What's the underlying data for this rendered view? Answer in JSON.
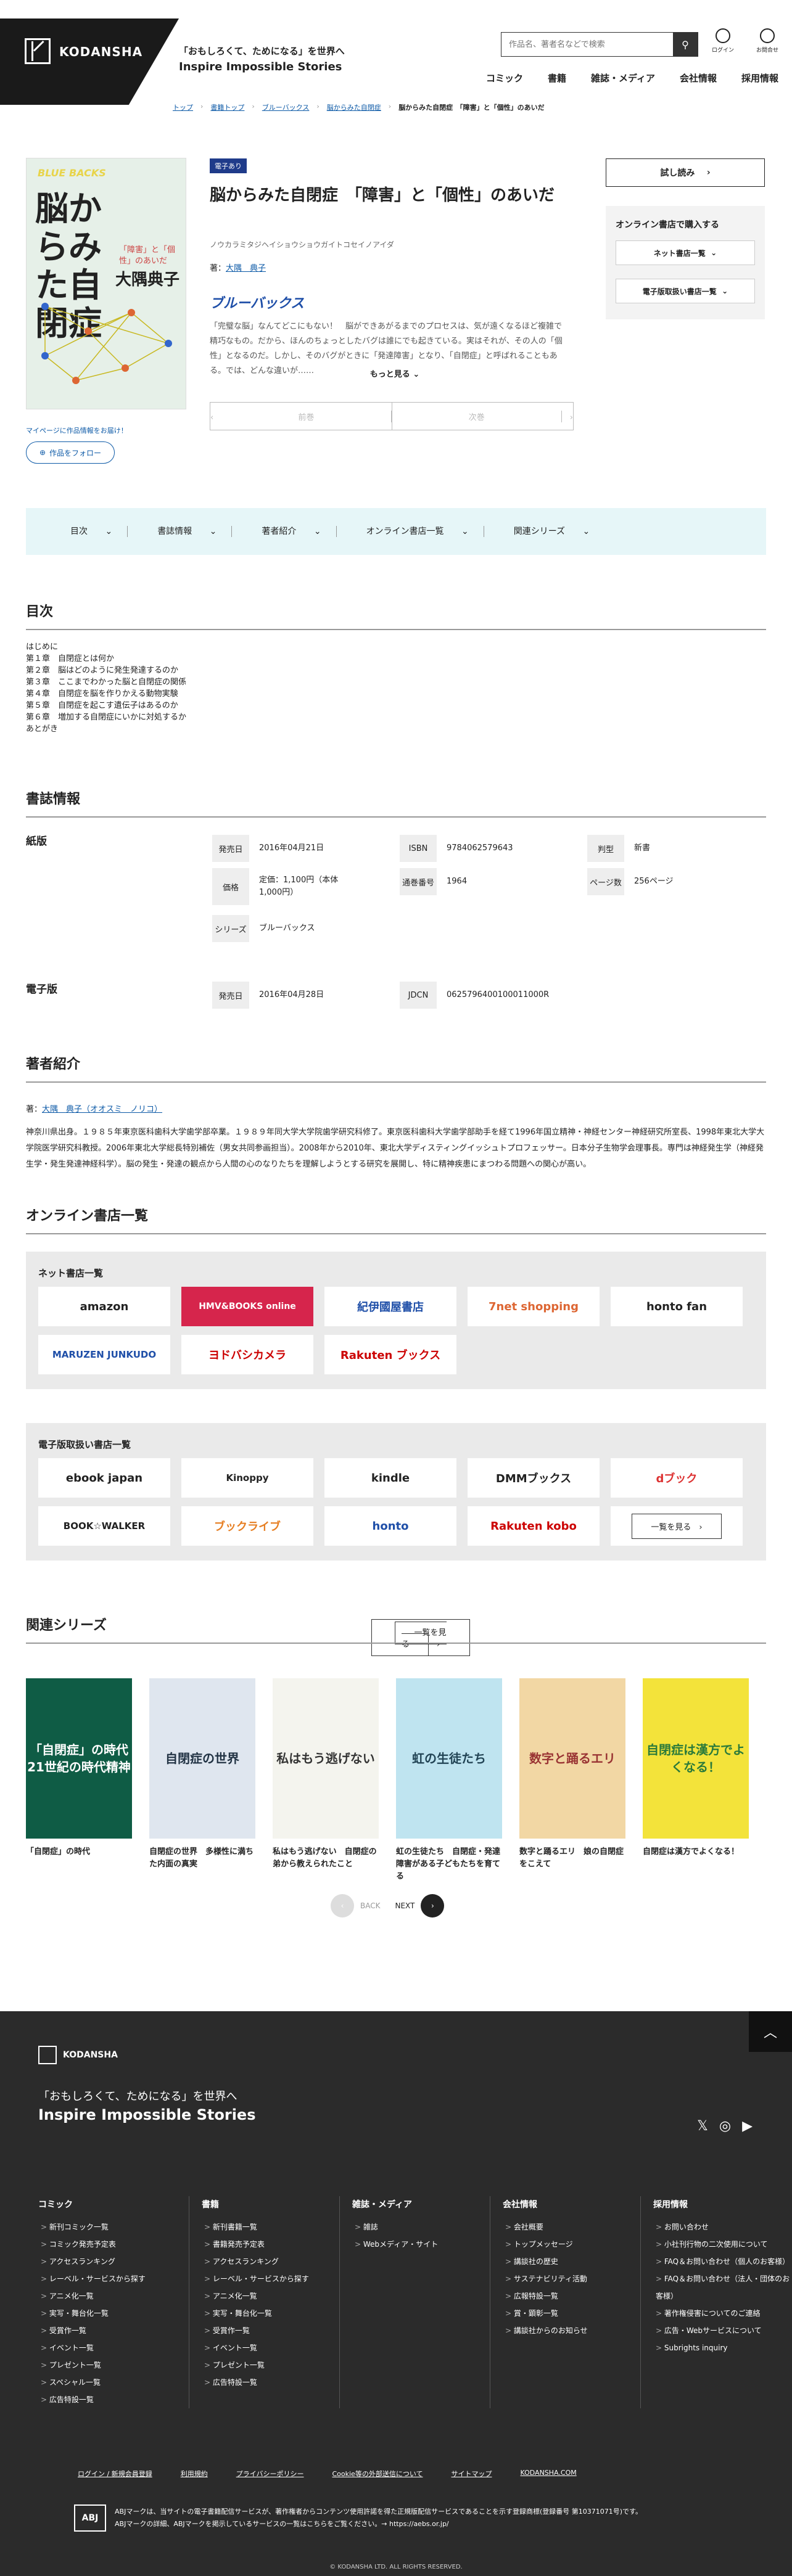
{
  "header": {
    "logo": "KODANSHA",
    "tagline1": "「おもしろくて、ためになる」を世界へ",
    "tagline2": "Inspire Impossible Stories",
    "search_placeholder": "作品名、著者名などで検索",
    "login": "ログイン",
    "notice": "お問合せ",
    "nav": [
      "コミック",
      "書籍",
      "雑誌・メディア",
      "会社情報",
      "採用情報"
    ]
  },
  "breadcrumb": {
    "items": [
      "トップ",
      "書籍トップ",
      "ブルーバックス",
      "脳からみた自閉症"
    ],
    "current": "脳からみた自閉症　「障害」と「個性」のあいだ"
  },
  "book": {
    "cover_series": "BLUE BACKS",
    "cover_title": "脳からみた自閉症",
    "cover_subtitle": "「障害」と「個性」のあいだ",
    "cover_author": "大隅典子",
    "badge": "電子あり",
    "title": "脳からみた自閉症　「障害」と「個性」のあいだ",
    "kana": "ノウカラミタジヘイショウショウガイトコセイノアイダ",
    "author_label": "著：",
    "author": "大隅　典子",
    "series_logo": "ブルーバックス",
    "description": "「完璧な脳」なんてどこにもない！　脳ができあがるまでのプロセスは、気が遠くなるほど複雑で精巧なもの。だから、ほんのちょっとしたバグは誰にでも起きている。実はそれが、その人の「個性」となるのだ。しかし、そのバグがときに「発達障害」となり、「自閉症」と呼ばれることもある。では、どんな違いが……",
    "more": "もっと見る",
    "prev": "前巻",
    "next": "次巻",
    "follow_note": "マイページに作品情報をお届け！",
    "follow": "作品をフォロー",
    "trial": "試し読み",
    "buy_heading": "オンライン書店で購入する",
    "net_stores": "ネット書店一覧",
    "ebook_stores": "電子版取扱い書店一覧"
  },
  "tabs": [
    "目次",
    "書誌情報",
    "著者紹介",
    "オンライン書店一覧",
    "関連シリーズ"
  ],
  "toc": {
    "heading": "目次",
    "items": [
      "はじめに",
      "第１章　自閉症とは何か",
      "第２章　脳はどのように発生発達するのか",
      "第３章　ここまでわかった脳と自閉症の関係",
      "第４章　自閉症を脳を作りかえる動物実験",
      "第５章　自閉症を起こす遺伝子はあるのか",
      "第６章　増加する自閉症にいかに対処するか",
      "あとがき"
    ]
  },
  "biblio": {
    "heading": "書誌情報",
    "paper": "紙版",
    "ebook": "電子版",
    "paper_rows": [
      [
        "発売日",
        "2016年04月21日"
      ],
      [
        "ISBN",
        "9784062579643"
      ],
      [
        "判型",
        "新書"
      ],
      [
        "価格",
        "定価：1,100円（本体1,000円）"
      ],
      [
        "通巻番号",
        "1964"
      ],
      [
        "ページ数",
        "256ページ"
      ],
      [
        "シリーズ",
        "ブルーバックス"
      ]
    ],
    "ebook_rows": [
      [
        "発売日",
        "2016年04月28日"
      ],
      [
        "JDCN",
        "0625796400100011000R"
      ]
    ]
  },
  "bio": {
    "heading": "著者紹介",
    "label": "著：",
    "name": "大隅　典子（オオスミ　ノリコ）",
    "text": "神奈川県出身。１９８５年東京医科歯科大学歯学部卒業。１９８９年同大学大学院歯学研究科修了。東京医科歯科大学歯学部助手を経て1996年国立精神・神経センター神経研究所室長、1998年東北大学大学院医学研究科教授。2006年東北大学総長特別補佐（男女共同参画担当）。2008年から2010年、東北大学ディスティングイッシュトプロフェッサー。日本分子生物学会理事長。専門は神経発生学（神経発生学・発生発達神経科学）。脳の発生・発達の観点から人間の心のなりたちを理解しようとする研究を展開し、特に精神疾患にまつわる問題への関心が高い。"
  },
  "stores": {
    "heading": "オンライン書店一覧",
    "net_heading": "ネット書店一覧",
    "net": [
      "amazon",
      "HMV&BOOKS online",
      "紀伊國屋書店",
      "7net shopping",
      "honto fan",
      "MARUZEN JUNKUDO",
      "ヨドバシカメラ",
      "Rakuten ブックス"
    ],
    "ebook_heading": "電子版取扱い書店一覧",
    "ebook": [
      "ebook japan",
      "Kinoppy",
      "kindle",
      "DMMブックス",
      "dブック",
      "BOOK☆WALKER",
      "ブックライブ",
      "honto",
      "Rakuten kobo"
    ],
    "more": "一覧を見る"
  },
  "series": {
    "heading": "関連シリーズ",
    "items": [
      {
        "cover": "「自閉症」の時代 21世紀の時代精神",
        "title": "「自閉症」の時代"
      },
      {
        "cover": "自閉症の世界",
        "title": "自閉症の世界　多様性に満ちた内面の真実"
      },
      {
        "cover": "私はもう逃げない",
        "title": "私はもう逃げない　自閉症の弟から教えられたこと"
      },
      {
        "cover": "虹の生徒たち",
        "title": "虹の生徒たち　自閉症・発達障害がある子どもたちを育てる"
      },
      {
        "cover": "数字と踊るエリ",
        "title": "数字と踊るエリ　娘の自閉症をこえて"
      },
      {
        "cover": "自閉症は漢方でよくなる！",
        "title": "自閉症は漢方でよくなる！"
      }
    ],
    "back": "BACK",
    "next": "NEXT"
  },
  "footer": {
    "logo": "KODANSHA",
    "slogan1": "「おもしろくて、ためになる」を世界へ",
    "slogan2": "Inspire Impossible Stories",
    "cols": [
      {
        "h": "コミック",
        "items": [
          "新刊コミック一覧",
          "コミック発売予定表",
          "アクセスランキング",
          "レーベル・サービスから探す",
          "アニメ化一覧",
          "実写・舞台化一覧",
          "受賞作一覧",
          "イベント一覧",
          "プレゼント一覧",
          "スペシャル一覧",
          "広告特設一覧"
        ]
      },
      {
        "h": "書籍",
        "items": [
          "新刊書籍一覧",
          "書籍発売予定表",
          "アクセスランキング",
          "レーベル・サービスから探す",
          "アニメ化一覧",
          "実写・舞台化一覧",
          "受賞作一覧",
          "イベント一覧",
          "プレゼント一覧",
          "広告特設一覧"
        ]
      },
      {
        "h": "雑誌・メディア",
        "items": [
          "雑誌",
          "Webメディア・サイト"
        ]
      },
      {
        "h": "会社情報",
        "items": [
          "会社概要",
          "トップメッセージ",
          "講談社の歴史",
          "サステナビリティ活動",
          "広報特設一覧",
          "賞・顕彰一覧",
          "講談社からのお知らせ"
        ]
      },
      {
        "h": "採用情報",
        "items": [
          "お問い合わせ",
          "小社刊行物の二次使用について",
          "FAQ＆お問い合わせ（個人のお客様）",
          "FAQ＆お問い合わせ（法人・団体のお客様）",
          "著作権侵害についてのご連絡",
          "広告・Webサービスについて",
          "Subrights inquiry"
        ]
      }
    ],
    "links": [
      "ログイン / 新規会員登録",
      "利用規約",
      "プライバシーポリシー",
      "Cookie等の外部送信について",
      "サイトマップ",
      "KODANSHA.COM"
    ],
    "abj": "ABJ",
    "abj_text1": "ABJマークは、当サイトの電子書籍配信サービスが、著作権者からコンテンツ使用許諾を得た正規版配信サービスであることを示す登録商標(登録番号 第10371071号)です。",
    "abj_text2": "ABJマークの詳細、ABJマークを掲示しているサービスの一覧はこちらをご覧ください。→ https://aebs.or.jp/",
    "copyright": "© KODANSHA LTD. ALL RIGHTS RESERVED."
  },
  "colors": {
    "accent": "#0d5aa7",
    "footer": "#2b2b2b",
    "tab_bg": "#e6f6f8"
  }
}
